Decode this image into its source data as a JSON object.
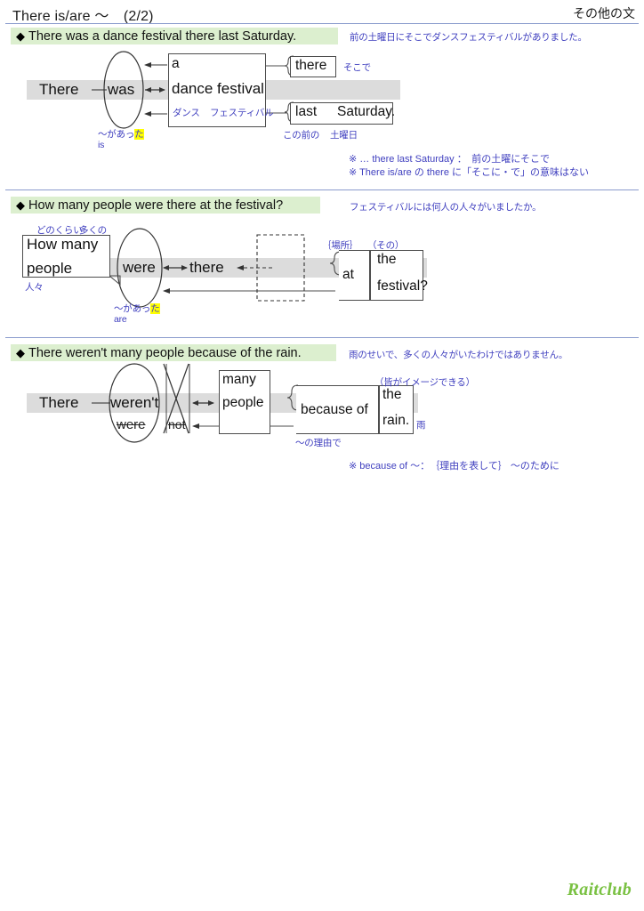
{
  "header": {
    "title": "There is/are 〜　(2/2)",
    "right_label": "その他の文"
  },
  "colors": {
    "section_bar": "#dcefcf",
    "band": "#dcdcdc",
    "jp_blue": "#3f3fbf",
    "rule": "#8a9bcd",
    "highlight": "#ffff00",
    "logo_green": "#7ac143"
  },
  "sections": [
    {
      "id": "s1",
      "diamond": "◆",
      "english": "There was a dance festival there last Saturday.",
      "japanese": "前の土曜日にそこでダンスフェスティバルがありました。",
      "diagram": {
        "subject": "There",
        "verb": "was",
        "verb_gloss_jp": "〜があっ",
        "verb_gloss_jp_hl": "た",
        "verb_alt": "is",
        "object_det": "a",
        "object_head": "dance festival",
        "object_gloss_1": "ダンス",
        "object_gloss_2": "フェスティバル",
        "adv_there": "there",
        "adv_there_jp": "そこで",
        "time_det": "last",
        "time_head": "Saturday.",
        "time_jp_1": "この前の",
        "time_jp_2": "土曜日"
      },
      "notes": [
        "※ … there last Saturday ：　前の土曜にそこで",
        "※ There is/are の there に「そこに・で」の意味はない"
      ]
    },
    {
      "id": "s2",
      "diamond": "◆",
      "english": "How many people were there at the festival?",
      "japanese": "フェスティバルには何人の人々がいましたか。",
      "diagram": {
        "subj_det": "How many",
        "subj_head": "people",
        "subj_gloss_1": "どのくらい",
        "subj_gloss_2": "多くの",
        "subj_gloss_head": "人々",
        "verb": "were",
        "verb_gloss_jp": "〜があっ",
        "verb_gloss_jp_hl": "た",
        "verb_alt": "are",
        "adv_there": "there",
        "prep": "at",
        "prep_gloss": "｛場所｝",
        "obj_det": "the",
        "obj_det_gloss": "（その）",
        "obj_head": "festival?"
      },
      "notes": []
    },
    {
      "id": "s3",
      "diamond": "◆",
      "english": "There weren't many people because of the rain.",
      "japanese": "雨のせいで、多くの人々がいたわけではありません。",
      "diagram": {
        "subject": "There",
        "verb": "weren't",
        "verb_alt": "were",
        "neg": "not",
        "obj_det": "many",
        "obj_head": "people",
        "prep": "because of",
        "prep_gloss": "〜の理由で",
        "obj2_det": "the",
        "obj2_det_gloss": "（皆がイメージできる）",
        "obj2_head": "rain.",
        "obj2_head_gloss": "雨"
      },
      "notes": [
        "※ because of 〜：　｛理由を表して｝ 〜のために"
      ]
    }
  ],
  "footer": {
    "logo": "Raitclub"
  }
}
